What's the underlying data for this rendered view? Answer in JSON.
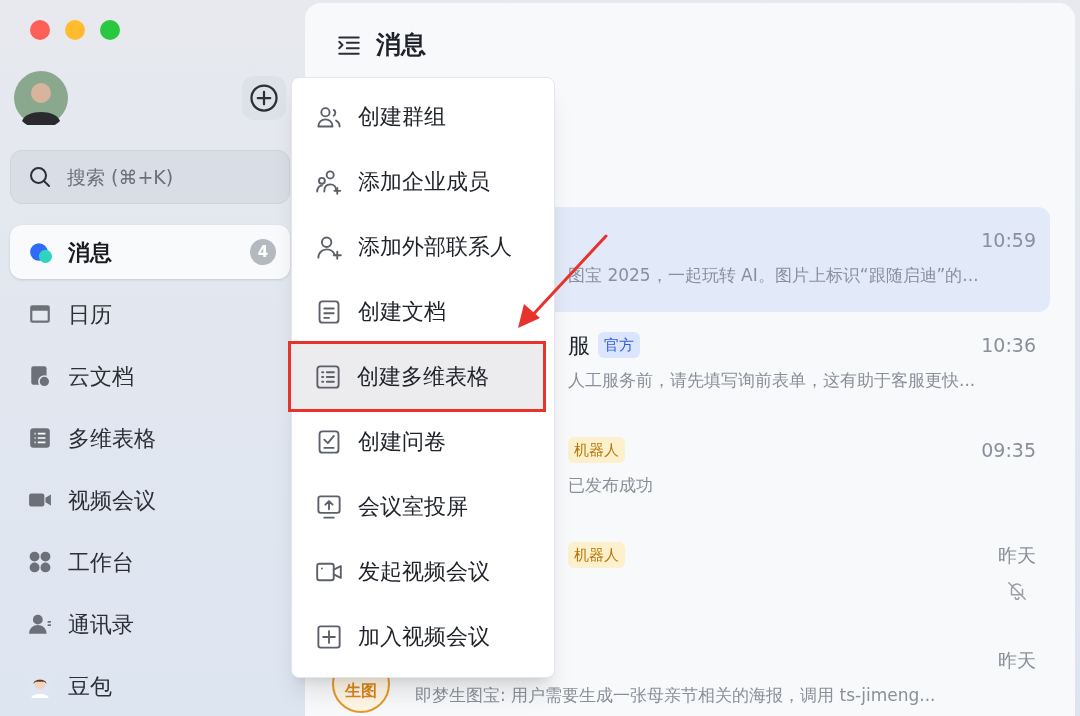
{
  "sidebar": {
    "search": {
      "placeholder": "搜索 (⌘+K)"
    },
    "nav": [
      {
        "label": "消息",
        "selected": true,
        "badge": "4"
      },
      {
        "label": "日历",
        "selected": false
      },
      {
        "label": "云文档",
        "selected": false
      },
      {
        "label": "多维表格",
        "selected": false
      },
      {
        "label": "视频会议",
        "selected": false
      },
      {
        "label": "工作台",
        "selected": false
      },
      {
        "label": "通讯录",
        "selected": false
      },
      {
        "label": "豆包",
        "selected": false
      }
    ]
  },
  "main": {
    "title": "消息",
    "chats": [
      {
        "selected": true,
        "time": "10:59",
        "preview": "图宝 2025，一起玩转 AI。图片上标识“跟随启迪”的...",
        "muted": false
      },
      {
        "selected": false,
        "name": "服",
        "tag": {
          "kind": "official",
          "text": "官方"
        },
        "time": "10:36",
        "preview": "人工服务前，请先填写询前表单，这有助于客服更快...",
        "muted": false
      },
      {
        "selected": false,
        "tag": {
          "kind": "bot",
          "text": "机器人"
        },
        "time": "09:35",
        "preview": "已发布成功",
        "muted": false
      },
      {
        "selected": false,
        "tag": {
          "kind": "bot",
          "text": "机器人"
        },
        "time": "昨天",
        "muted": true
      },
      {
        "selected": false,
        "avatar_text": "生图",
        "time": "昨天",
        "preview": "即梦生图宝: 用户需要生成一张母亲节相关的海报，调用 ts-jimeng...",
        "muted": false
      }
    ]
  },
  "menu": {
    "items": [
      {
        "label": "创建群组",
        "selected": false
      },
      {
        "label": "添加企业成员",
        "selected": false
      },
      {
        "label": "添加外部联系人",
        "selected": false
      },
      {
        "label": "创建文档",
        "selected": false
      },
      {
        "label": "创建多维表格",
        "selected": true
      },
      {
        "label": "创建问卷",
        "selected": false
      },
      {
        "label": "会议室投屏",
        "selected": false
      },
      {
        "label": "发起视频会议",
        "selected": false
      },
      {
        "label": "加入视频会议",
        "selected": false
      }
    ]
  }
}
